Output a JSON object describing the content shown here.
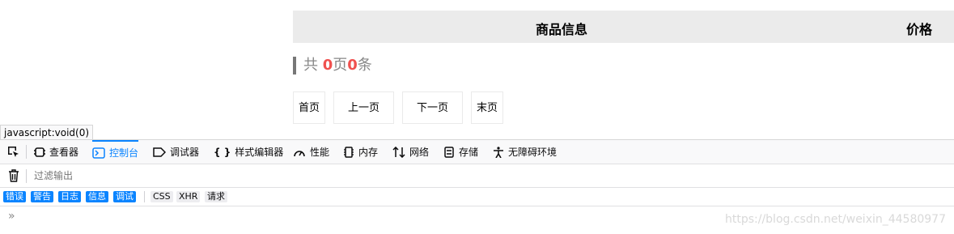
{
  "table": {
    "col_product": "商品信息",
    "col_price": "价格"
  },
  "pagination": {
    "prefix": "共 ",
    "total_pages": "0",
    "pages_unit": "页",
    "total_items": "0",
    "items_unit": "条",
    "buttons": [
      "首页",
      "上一页",
      "下一页",
      "末页"
    ]
  },
  "status_tooltip": "javascript:void(0)",
  "devtools": {
    "tabs": [
      "查看器",
      "控制台",
      "调试器",
      "样式编辑器",
      "性能",
      "内存",
      "网络",
      "存储",
      "无障碍环境"
    ],
    "active_tab": "控制台",
    "filter_placeholder": "过滤输出",
    "levels": [
      "错误",
      "警告",
      "日志",
      "信息",
      "调试"
    ],
    "requests": [
      "CSS",
      "XHR",
      "请求"
    ],
    "prompt": "»",
    "accent_color": "#0a84ff"
  },
  "watermark": "https://blog.csdn.net/weixin_44580977"
}
